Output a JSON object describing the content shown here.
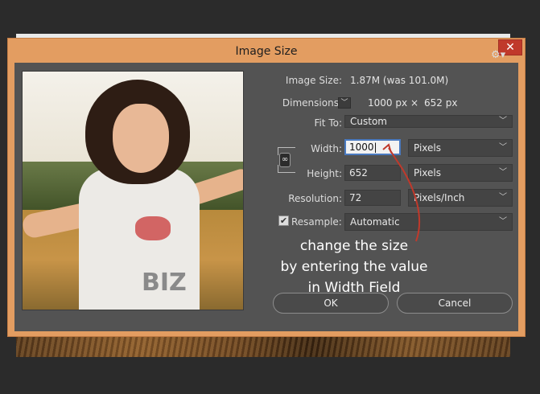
{
  "dialog": {
    "title": "Image Size",
    "close_glyph": "✕"
  },
  "info": {
    "image_size_label": "Image Size:",
    "image_size_value": "1.87M (was 101.0M)",
    "dimensions_label": "Dimensions:",
    "dimensions_width": "1000 px",
    "dimensions_times": "×",
    "dimensions_height": "652 px"
  },
  "fit_to": {
    "label": "Fit To:",
    "value": "Custom"
  },
  "width": {
    "label": "Width:",
    "value": "1000",
    "unit": "Pixels"
  },
  "height": {
    "label": "Height:",
    "value": "652",
    "unit": "Pixels"
  },
  "resolution": {
    "label": "Resolution:",
    "value": "72",
    "unit": "Pixels/Inch"
  },
  "resample": {
    "label": "Resample:",
    "checked": true,
    "value": "Automatic"
  },
  "annotation": {
    "line1": "change the size",
    "line2": "by entering the value",
    "line3": "in Width Field",
    "arrow_color": "#c0392b"
  },
  "buttons": {
    "ok_label": "OK",
    "cancel_label": "Cancel"
  },
  "icons": {
    "gear": "gear-icon",
    "chain": "link-chain-icon",
    "chevron": "chevron-down-icon",
    "check": "checkmark-icon"
  }
}
